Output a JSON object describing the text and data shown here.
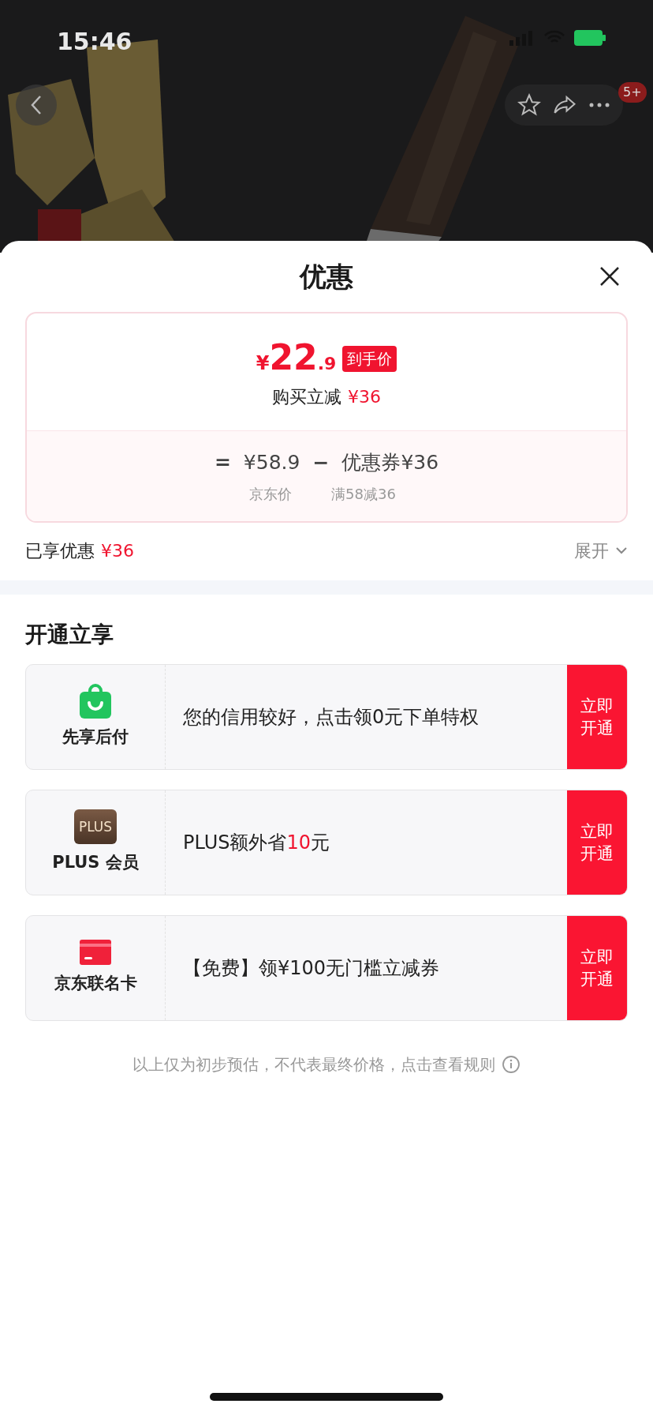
{
  "status_bar": {
    "time": "15:46"
  },
  "nav": {
    "badge": "5+"
  },
  "sheet": {
    "title": "优惠",
    "price": {
      "currency": "¥",
      "integer": "22",
      "decimal": ".9",
      "tag": "到手价",
      "discount_label": "购买立减",
      "discount_value": "¥36"
    },
    "breakdown": {
      "equals": "=",
      "minus": "−",
      "items": [
        {
          "value": "¥58.9",
          "caption": "京东价"
        },
        {
          "value": "优惠券¥36",
          "caption": "满58减36"
        }
      ]
    },
    "enjoyed": {
      "label": "已享优惠",
      "value": "¥36"
    },
    "expand": "展开",
    "section_title": "开通立享",
    "offers": [
      {
        "kind": "bag",
        "name": "先享后付",
        "text_parts": [
          {
            "text": "您的信用较好，点击领0元下单特权",
            "highlight": false
          }
        ],
        "button": "立即开通"
      },
      {
        "kind": "plus",
        "icon_text": "PLUS",
        "name": "PLUS 会员",
        "text_parts": [
          {
            "text": "PLUS额外省 ",
            "highlight": false
          },
          {
            "text": "10",
            "highlight": true
          },
          {
            "text": " 元",
            "highlight": false
          }
        ],
        "button": "立即开通"
      },
      {
        "kind": "card",
        "name": "京东联名卡",
        "text_parts": [
          {
            "text": "【免费】领¥100无门槛立减券",
            "highlight": false
          }
        ],
        "button": "立即开通"
      }
    ],
    "footnote": "以上仅为初步预估，不代表最终价格，点击查看规则"
  }
}
